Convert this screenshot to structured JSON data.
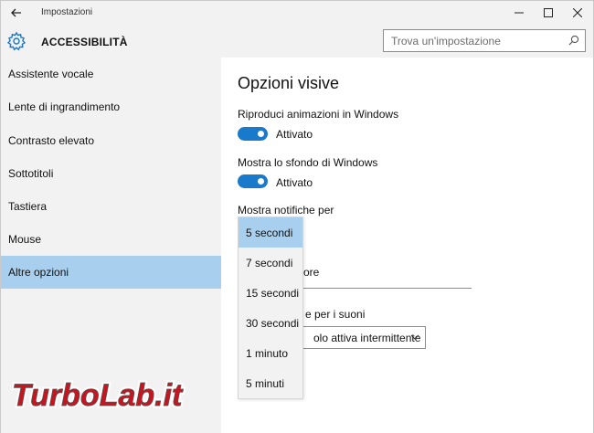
{
  "window": {
    "title": "Impostazioni",
    "header_title": "ACCESSIBILITÀ"
  },
  "search": {
    "placeholder": "Trova un'impostazione"
  },
  "sidebar": {
    "items": [
      {
        "label": "Assistente vocale",
        "selected": false
      },
      {
        "label": "Lente di ingrandimento",
        "selected": false
      },
      {
        "label": "Contrasto elevato",
        "selected": false
      },
      {
        "label": "Sottotitoli",
        "selected": false
      },
      {
        "label": "Tastiera",
        "selected": false
      },
      {
        "label": "Mouse",
        "selected": false
      },
      {
        "label": "Altre opzioni",
        "selected": true
      }
    ]
  },
  "main": {
    "section_title": "Opzioni visive",
    "settings": [
      {
        "label": "Riproduci animazioni in Windows",
        "state": "Attivato"
      },
      {
        "label": "Mostra lo sfondo di Windows",
        "state": "Attivato"
      }
    ],
    "notifications_label": "Mostra notifiche per",
    "partial_label_1": "ore",
    "partial_label_2": "e per i suoni",
    "partial_select_value": "olo attiva intermittente"
  },
  "dropdown": {
    "options": [
      "5 secondi",
      "7 secondi",
      "15 secondi",
      "30 secondi",
      "1 minuto",
      "5 minuti"
    ],
    "selected": "5 secondi"
  },
  "watermark": {
    "text": "TurboLab.it"
  },
  "colors": {
    "accent": "#1979ca",
    "selection": "#a8d0ee",
    "chrome": "#f2f2f2",
    "watermark_red": "#c8141e"
  }
}
